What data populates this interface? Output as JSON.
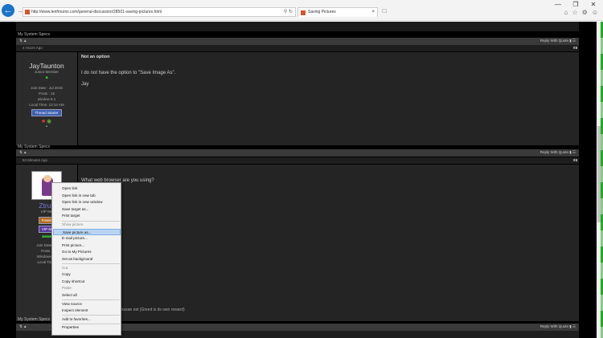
{
  "browser": {
    "url": "http://www.tenforums.com/general-discussion/28501-saving-pictures.html",
    "tab_title": "Saving Pictures"
  },
  "posts": [
    {
      "specs_label": "My System Specs",
      "date": "4 Hours Ago",
      "number": "#3",
      "username": "JayTaunton",
      "rank": "Junior Member",
      "join_date": "Join Date : Jul 2015",
      "posts": "Posts : 15",
      "os": "window 8.1",
      "local_time": "Local Time: 12:14 AM",
      "badge": "Thread Starter",
      "title": "Not an option",
      "body": "I do not have the option to \"Save Image As\".",
      "signature": "Jay"
    },
    {
      "specs_label": "My System Specs",
      "date": "53 Minutes Ago",
      "number": "#4",
      "username": "Ztruk",
      "rank": "VIP Me",
      "badge1": "Power",
      "badge2": "VIP M",
      "join_date": "Join Date : A",
      "posts": "Posts :",
      "os": "Windows 10",
      "local_time": "Local Time:",
      "body": "What web browser are you using?",
      "signature_text": "susan est (Greed is its own reward)"
    }
  ],
  "toolbar": {
    "reply_label": "Reply With Quote"
  },
  "last_specs_label": "My System Specs",
  "context_menu": [
    {
      "label": "Open link",
      "disabled": false
    },
    {
      "label": "Open link in new tab",
      "disabled": false
    },
    {
      "label": "Open link in new window",
      "disabled": false
    },
    {
      "label": "Save target as...",
      "disabled": false
    },
    {
      "label": "Print target",
      "disabled": false
    },
    {
      "label": "Show picture",
      "disabled": true
    },
    {
      "label": "Save picture as...",
      "disabled": false,
      "highlighted": true
    },
    {
      "label": "E-mail picture...",
      "disabled": false
    },
    {
      "label": "Print picture...",
      "disabled": false
    },
    {
      "label": "Go to My Pictures",
      "disabled": false
    },
    {
      "label": "Set as background",
      "disabled": false
    },
    {
      "label": "Cut",
      "disabled": true
    },
    {
      "label": "Copy",
      "disabled": false
    },
    {
      "label": "Copy shortcut",
      "disabled": false
    },
    {
      "label": "Paste",
      "disabled": true
    },
    {
      "label": "Select all",
      "disabled": false
    },
    {
      "label": "View source",
      "disabled": false
    },
    {
      "label": "Inspect element",
      "disabled": false
    },
    {
      "label": "Add to favorites...",
      "disabled": false
    },
    {
      "label": "Properties",
      "disabled": false
    }
  ]
}
